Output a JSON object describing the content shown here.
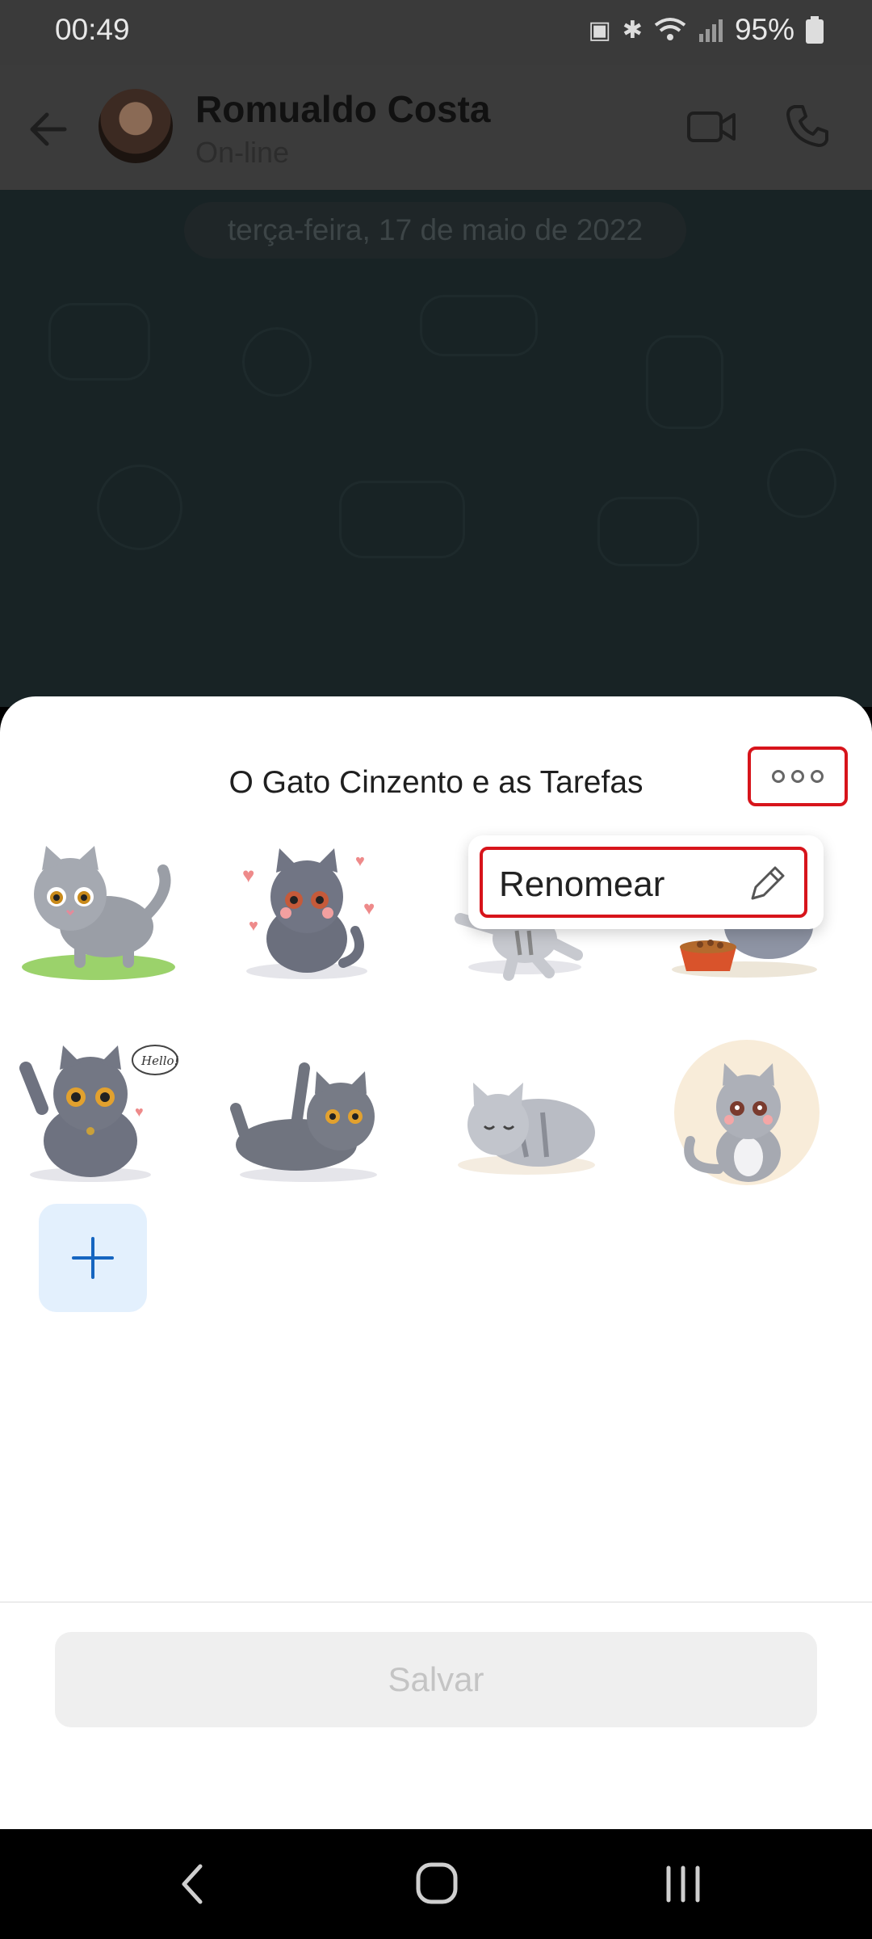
{
  "status_bar": {
    "time": "00:49",
    "battery": "95%",
    "icons": [
      "nfc-icon",
      "bluetooth-icon",
      "wifi-icon",
      "signal-icon",
      "battery-icon"
    ]
  },
  "header": {
    "contact_name": "Romualdo Costa",
    "contact_status": "On-line",
    "icons": [
      "back-arrow-icon",
      "video-call-icon",
      "phone-icon"
    ]
  },
  "chat": {
    "date_label": "terça-feira, 17 de maio de 2022"
  },
  "sheet": {
    "title": "O Gato Cinzento e as Tarefas",
    "more_icon": "more-horizontal-icon",
    "stickers": [
      "cat-walking-on-grass",
      "cat-with-hearts",
      "cat-dancing",
      "cat-with-food-bowl",
      "cat-waving-hello",
      "cat-lying-waving",
      "cat-sleeping",
      "cat-sitting-smiling"
    ],
    "hello_bubble": "Hello!",
    "add_icon": "plus-icon",
    "save_label": "Salvar"
  },
  "context_menu": {
    "rename_label": "Renomear",
    "rename_icon": "pencil-icon"
  },
  "nav_bar": {
    "icons": [
      "nav-back-icon",
      "nav-home-icon",
      "nav-recents-icon"
    ]
  },
  "colors": {
    "highlight": "#d7141b",
    "add_tile": "#e3f0fd",
    "accent_blue": "#1565c0"
  }
}
